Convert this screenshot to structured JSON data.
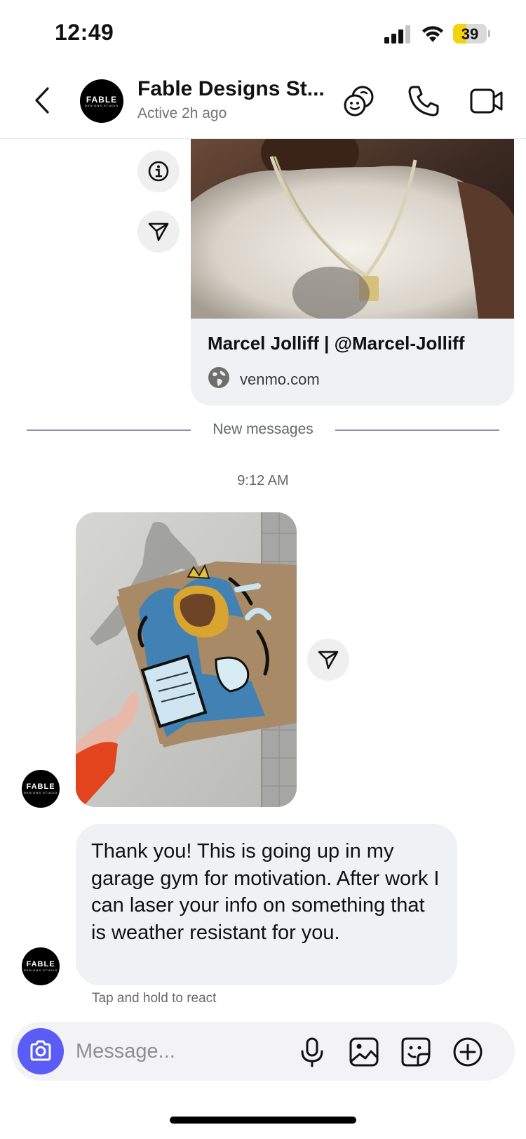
{
  "status_bar": {
    "time": "12:49",
    "battery": "39",
    "battery_level": 0.39
  },
  "header": {
    "contact_name": "Fable Designs St...",
    "status": "Active 2h ago",
    "avatar_logo": "FABLE",
    "avatar_logo_sub": "DESIGNS STUDIO"
  },
  "link_preview": {
    "title": "Marcel Jolliff | @Marcel-Jolliff",
    "domain": "venmo.com"
  },
  "divider": {
    "label": "New messages"
  },
  "thread": {
    "timestamp": "9:12 AM",
    "message_text": "Thank you! This is going up in my garage gym for motivation. After work I can laser your info on something that is weather resistant for you.",
    "hint": "Tap and hold to react"
  },
  "composer": {
    "placeholder": "Message..."
  },
  "colors": {
    "accent": "#5b5cf6",
    "bubble": "#eff1f4",
    "battery": "#f5d20c"
  },
  "icons": [
    "chevron-left-icon",
    "effects-icon",
    "phone-icon",
    "video-icon",
    "info-icon",
    "share-icon",
    "globe-icon",
    "camera-icon",
    "microphone-icon",
    "gallery-icon",
    "sticker-icon",
    "plus-icon"
  ]
}
